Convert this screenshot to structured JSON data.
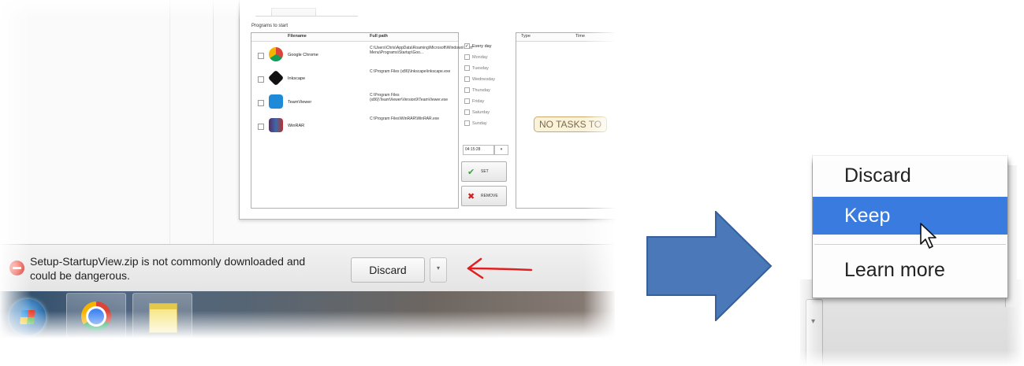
{
  "app_window": {
    "section_label": "Programs to start",
    "table_headers": [
      "Filename",
      "Full path"
    ],
    "programs": [
      {
        "name": "Google Chrome",
        "path": "C:\\Users\\Chris\\AppData\\Roaming\\Microsoft\\Windows\\Start Menu\\Programs\\Startup\\Goo..."
      },
      {
        "name": "Inkscape",
        "path": "C:\\Program Files (x86)\\Inkscape\\inkscape.exe"
      },
      {
        "name": "TeamViewer",
        "path": "C:\\Program Files (x86)\\TeamViewer\\Version9\\TeamViewer.exe"
      },
      {
        "name": "WinRAR",
        "path": "C:\\Program Files\\WinRAR\\WinRAR.exe"
      }
    ],
    "days": [
      "Every day",
      "Monday",
      "Tuesday",
      "Wednesday",
      "Thursday",
      "Friday",
      "Saturday",
      "Sunday"
    ],
    "time_value": "04:15:28",
    "set_button": "SET",
    "remove_button": "REMOVE",
    "tasks_headers": [
      "Type",
      "Time"
    ],
    "no_tasks_text": "NO TASKS TO"
  },
  "download_bar": {
    "message": "Setup-StartupView.zip is not commonly downloaded and could be dangerous.",
    "discard_label": "Discard",
    "dropdown_glyph": "▾"
  },
  "context_menu": {
    "items": [
      "Discard",
      "Keep",
      "Learn more"
    ],
    "highlighted": "Keep"
  },
  "colors": {
    "menu_highlight": "#3a7be0",
    "big_arrow": "#4a78b8",
    "red_annotation": "#e02020"
  }
}
